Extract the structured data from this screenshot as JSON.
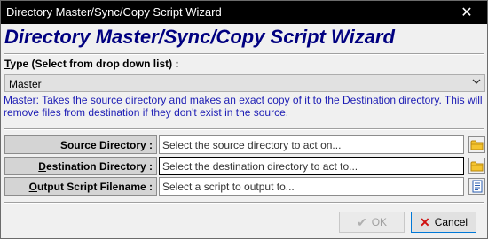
{
  "window": {
    "title": "Directory Master/Sync/Copy Script Wizard"
  },
  "header": {
    "title": "Directory Master/Sync/Copy Script Wizard"
  },
  "type": {
    "label_prefix": "",
    "label_mnemonic": "T",
    "label_rest": "ype (Select from drop down list) :",
    "selected": "Master"
  },
  "description": "Master: Takes the source directory and makes an exact copy of it to the Destination directory.  This will remove files from destination if they don't exist in the source.",
  "fields": [
    {
      "label_mnemonic": "S",
      "label_rest": "ource Directory :",
      "placeholder": "Select the source directory to act on..."
    },
    {
      "label_mnemonic": "D",
      "label_rest": "estination Directory :",
      "placeholder": "Select the destination directory to act to..."
    },
    {
      "label_mnemonic": "O",
      "label_rest": "utput Script Filename :",
      "placeholder": "Select a script to output to..."
    }
  ],
  "buttons": {
    "ok_mnemonic": "O",
    "ok_rest": "K",
    "cancel": "Cancel"
  },
  "colors": {
    "title_blue": "#000080",
    "description_blue": "#1c1cb4",
    "folder_yellow": "#e8b800",
    "cancel_red": "#d01010"
  }
}
